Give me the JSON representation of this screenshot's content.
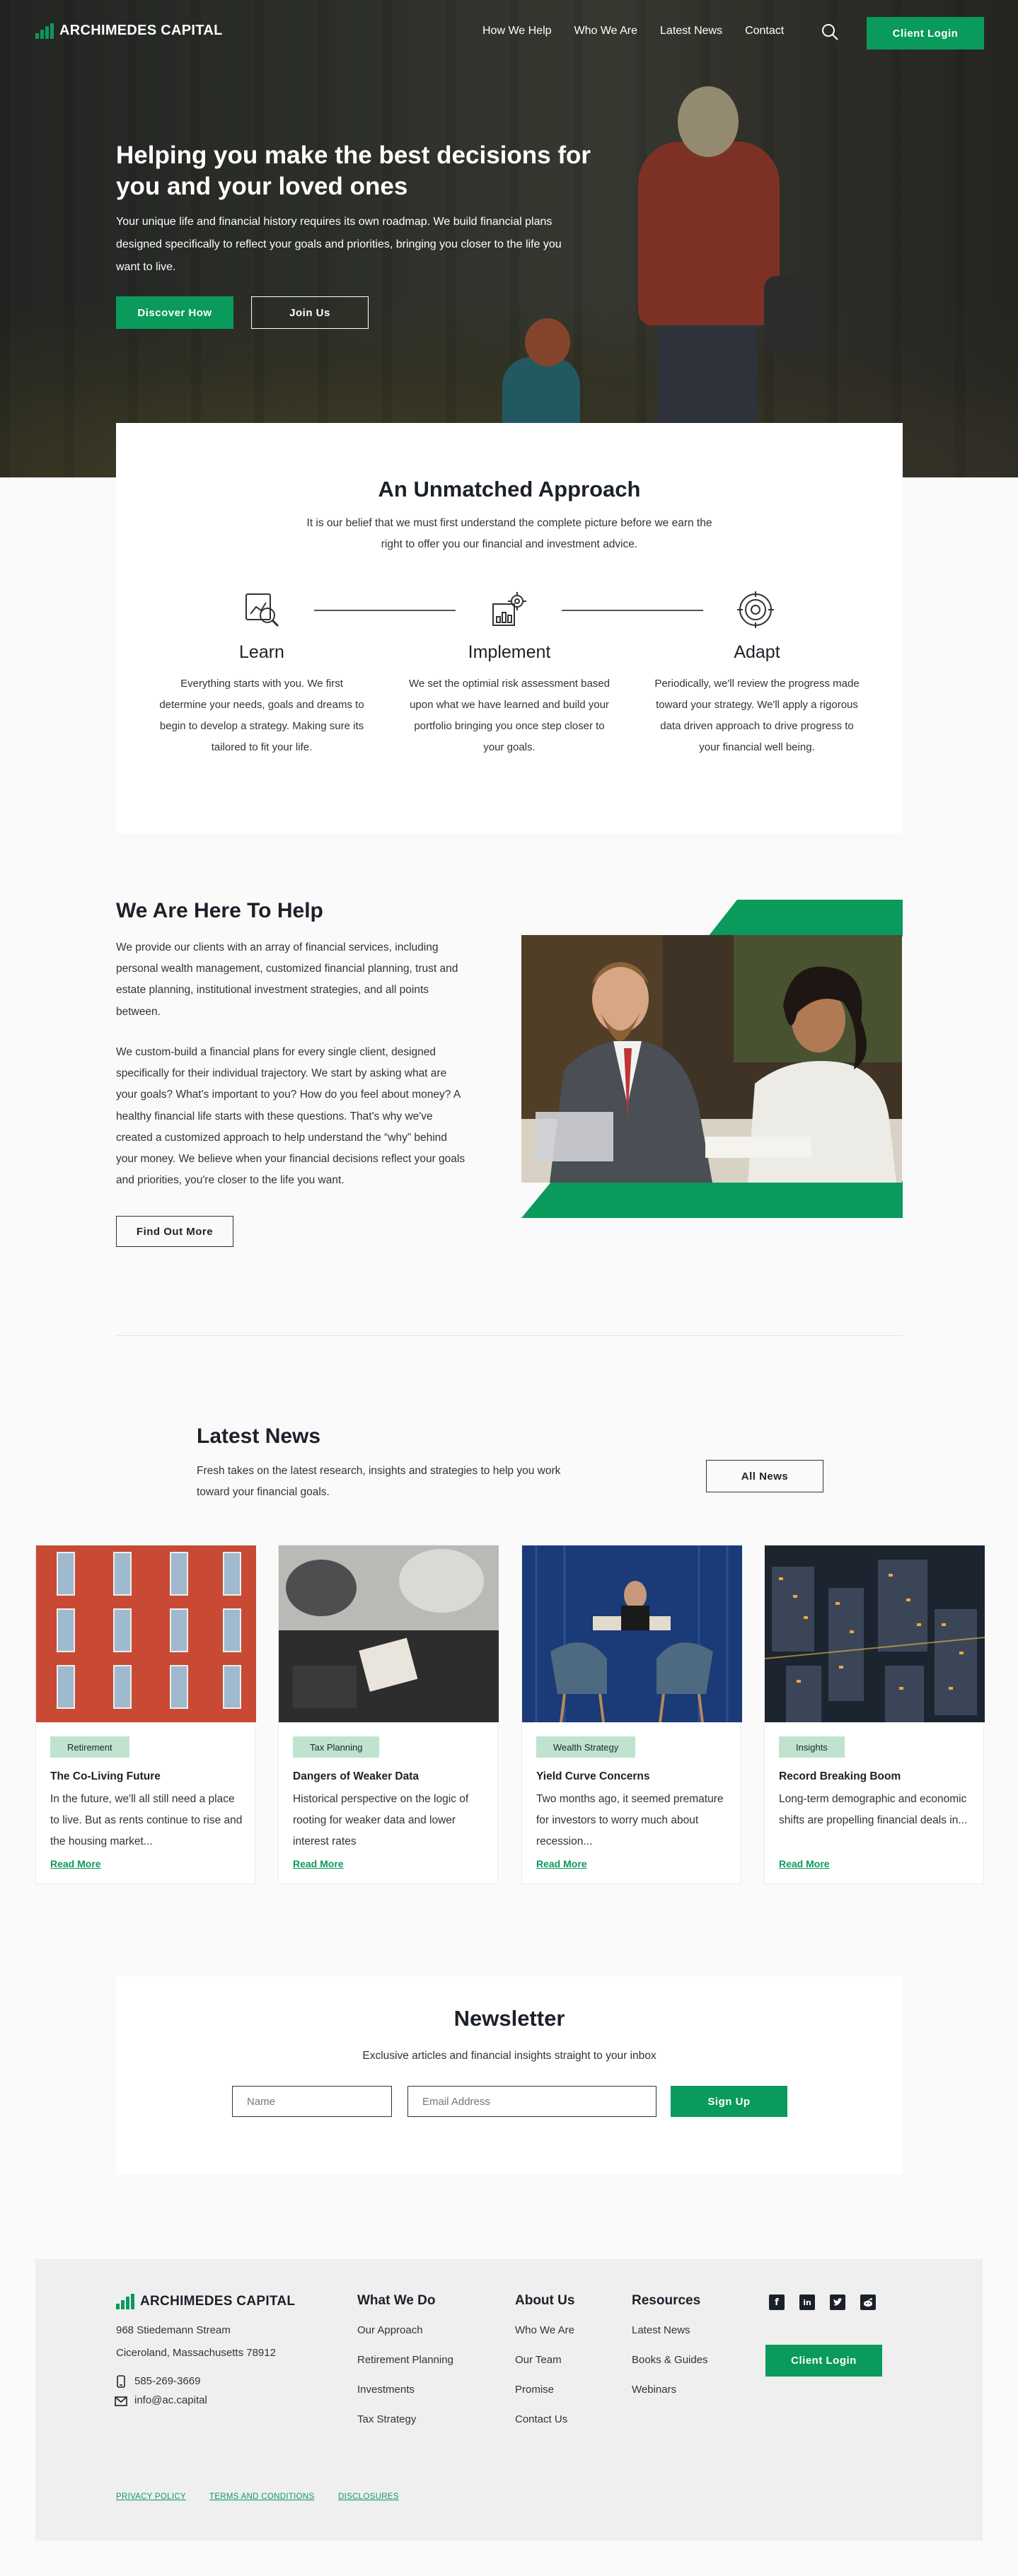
{
  "header": {
    "logo_text": "ARCHIMEDES CAPITAL",
    "nav": [
      "How We Help",
      "Who We Are",
      "Latest News",
      "Contact"
    ],
    "search_icon": "search-icon",
    "client_login": "Client Login"
  },
  "hero": {
    "title": "Helping you make the best decisions for you and your loved ones",
    "text": "Your unique life and financial history requires its own roadmap. We build financial plans designed specifically to reflect your goals and priorities, bringing you closer to the life you want to live.",
    "primary_button": "Discover How",
    "secondary_button": "Join Us"
  },
  "approach": {
    "title": "An Unmatched Approach",
    "intro": "It is our belief that we must first understand the complete picture before we earn the right to offer you our financial and investment advice.",
    "steps": [
      {
        "icon": "magnifier-chart-icon",
        "title": "Learn",
        "text": "Everything starts with you. We first determine your needs, goals and dreams to begin to develop a strategy. Making sure its tailored to fit your life."
      },
      {
        "icon": "gear-chart-icon",
        "title": "Implement",
        "text": "We set the optimial risk assessment based upon what we have learned and build your portfolio bringing you once step closer to your goals."
      },
      {
        "icon": "target-icon",
        "title": "Adapt",
        "text": "Periodically, we'll review the progress made toward your strategy. We'll apply a rigorous data driven approach to drive progress to your financial well being."
      }
    ]
  },
  "help": {
    "title": "We Are Here To Help",
    "para1": "We provide our clients with an array of financial services, including personal wealth management, customized financial planning, trust and estate planning, institutional investment strategies, and all points between.",
    "para2": "We custom-build a financial plans for every single client, designed specifically for their individual trajectory. We start by asking what are your goals? What's important to you? How do you feel about money? A healthy financial life starts with these questions. That's why we've created a customized approach to help understand the “why” behind your money. We believe when your financial decisions reflect your goals and priorities, you're closer to the life you want.",
    "button": "Find Out More"
  },
  "news": {
    "title": "Latest News",
    "intro": "Fresh takes on the latest research, insights and strategies to help you work toward your financial goals.",
    "all_button": "All News",
    "read_more": "Read More",
    "cards": [
      {
        "tag": "Retirement",
        "title": "The Co-Living Future",
        "excerpt": "In the future, we'll all still need a place to live. But as rents continue to rise and the housing market..."
      },
      {
        "tag": "Tax Planning",
        "title": "Dangers of Weaker Data",
        "excerpt": "Historical perspective on the logic of rooting for weaker data and lower interest rates"
      },
      {
        "tag": "Wealth Strategy",
        "title": "Yield Curve Concerns",
        "excerpt": "Two months ago, it seemed premature for investors to worry much about recession..."
      },
      {
        "tag": "Insights",
        "title": "Record Breaking Boom",
        "excerpt": "Long-term demographic and economic shifts are propelling financial deals in..."
      }
    ]
  },
  "newsletter": {
    "title": "Newsletter",
    "subtitle": "Exclusive articles and financial insights straight to your inbox",
    "name_placeholder": "Name",
    "email_placeholder": "Email Address",
    "button": "Sign Up"
  },
  "footer": {
    "logo_text": "ARCHIMEDES CAPITAL",
    "address1": "968 Stiedemann Stream",
    "address2": "Ciceroland, Massachusetts 78912",
    "phone": "585-269-3669",
    "email": "info@ac.capital",
    "columns": [
      {
        "title": "What We Do",
        "links": [
          "Our Approach",
          "Retirement Planning",
          "Investments",
          "Tax Strategy"
        ]
      },
      {
        "title": "About Us",
        "links": [
          "Who We Are",
          "Our Team",
          "Promise",
          "Contact Us"
        ]
      },
      {
        "title": "Resources",
        "links": [
          "Latest News",
          "Books & Guides",
          "Webinars"
        ]
      }
    ],
    "social": [
      "facebook-icon",
      "linkedin-icon",
      "twitter-icon",
      "reddit-icon"
    ],
    "client_login": "Client Login",
    "legal": [
      "PRIVACY POLICY",
      "TERMS AND CONDITIONS",
      "DISCLOSURES"
    ]
  },
  "colors": {
    "accent": "#0a9a5c",
    "tag_bg": "#bfe3cf",
    "text": "#1c2129",
    "footer_bg": "#efefef"
  }
}
